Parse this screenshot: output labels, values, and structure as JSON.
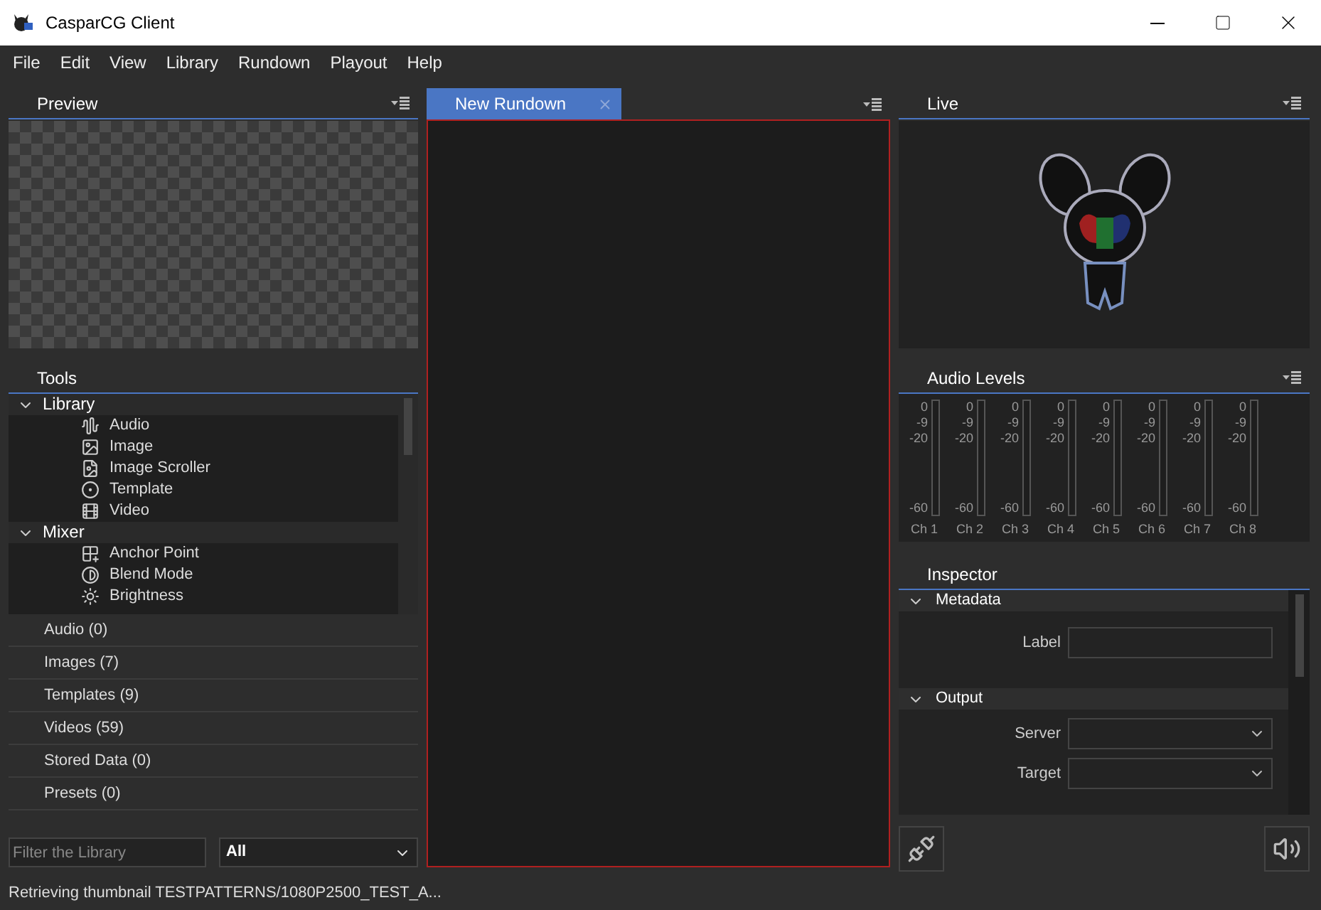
{
  "window": {
    "title": "CasparCG Client"
  },
  "menu": [
    "File",
    "Edit",
    "View",
    "Library",
    "Rundown",
    "Playout",
    "Help"
  ],
  "preview": {
    "title": "Preview"
  },
  "tools": {
    "title": "Tools",
    "groups": [
      {
        "label": "Library",
        "expanded": true,
        "children": [
          {
            "label": "Audio",
            "kind": "audio"
          },
          {
            "label": "Image",
            "kind": "image"
          },
          {
            "label": "Image Scroller",
            "kind": "scroller"
          },
          {
            "label": "Template",
            "kind": "template"
          },
          {
            "label": "Video",
            "kind": "video"
          }
        ]
      },
      {
        "label": "Mixer",
        "expanded": true,
        "children": [
          {
            "label": "Anchor Point",
            "kind": "anchor"
          },
          {
            "label": "Blend Mode",
            "kind": "blend"
          },
          {
            "label": "Brightness",
            "kind": "brightness"
          }
        ]
      }
    ]
  },
  "library": {
    "categories": [
      "Audio (0)",
      "Images (7)",
      "Templates (9)",
      "Videos (59)",
      "Stored Data (0)",
      "Presets (0)"
    ],
    "filter": {
      "placeholder": "Filter the Library"
    },
    "type_select": {
      "value": "All"
    }
  },
  "rundown": {
    "tabs": [
      {
        "label": "New Rundown",
        "selected": true
      }
    ]
  },
  "live": {
    "title": "Live"
  },
  "audio_levels": {
    "title": "Audio Levels",
    "channels": [
      {
        "name": "Ch 1",
        "scale": [
          "0",
          "-9",
          "-20",
          "-60"
        ]
      },
      {
        "name": "Ch 2",
        "scale": [
          "0",
          "-9",
          "-20",
          "-60"
        ]
      },
      {
        "name": "Ch 3",
        "scale": [
          "0",
          "-9",
          "-20",
          "-60"
        ]
      },
      {
        "name": "Ch 4",
        "scale": [
          "0",
          "-9",
          "-20",
          "-60"
        ]
      },
      {
        "name": "Ch 5",
        "scale": [
          "0",
          "-9",
          "-20",
          "-60"
        ]
      },
      {
        "name": "Ch 6",
        "scale": [
          "0",
          "-9",
          "-20",
          "-60"
        ]
      },
      {
        "name": "Ch 7",
        "scale": [
          "0",
          "-9",
          "-20",
          "-60"
        ]
      },
      {
        "name": "Ch 8",
        "scale": [
          "0",
          "-9",
          "-20",
          "-60"
        ]
      }
    ]
  },
  "inspector": {
    "title": "Inspector",
    "sections": [
      {
        "title": "Metadata",
        "expanded": true,
        "fields": [
          {
            "label": "Label",
            "kind": "text"
          }
        ]
      },
      {
        "title": "Output",
        "expanded": true,
        "fields": [
          {
            "label": "Server",
            "kind": "select"
          },
          {
            "label": "Target",
            "kind": "select"
          }
        ]
      }
    ]
  },
  "status_bar": {
    "text": "Retrieving thumbnail TESTPATTERNS/1080P2500_TEST_A..."
  }
}
